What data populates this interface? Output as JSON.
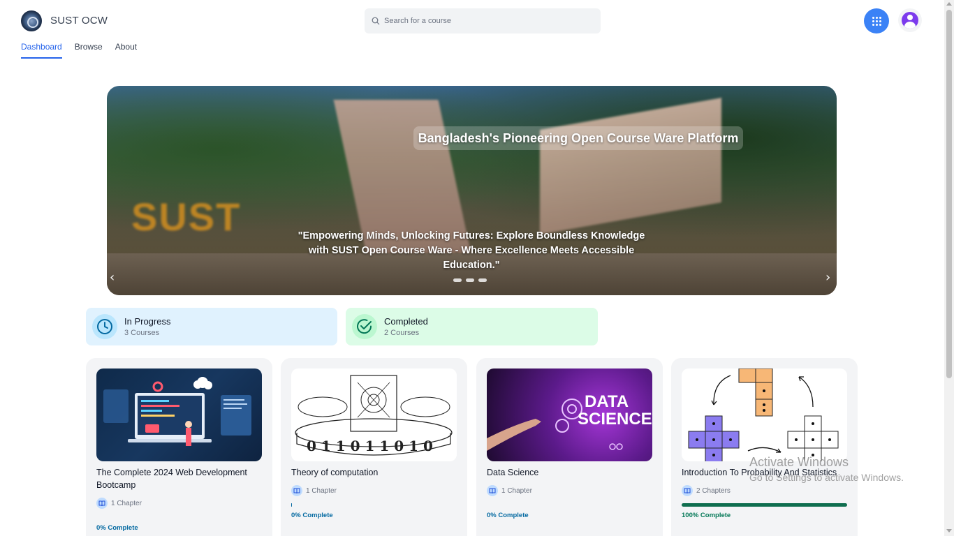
{
  "header": {
    "brand": "SUST OCW",
    "nav": [
      {
        "label": "Dashboard",
        "active": true
      },
      {
        "label": "Browse",
        "active": false
      },
      {
        "label": "About",
        "active": false
      }
    ],
    "search_placeholder": "Search for a course",
    "accent_color": "#2563eb"
  },
  "hero": {
    "title": "Bangladesh's Pioneering Open Course Ware Platform",
    "quote": "\"Empowering Minds, Unlocking Futures: Explore Boundless Knowledge with SUST Open Course Ware - Where Excellence Meets Accessible Education.\"",
    "sign_text": "SUST",
    "slide_count": 3,
    "prev_icon": "chevron-left-icon",
    "next_icon": "chevron-right-icon"
  },
  "status": {
    "in_progress": {
      "title": "In Progress",
      "count": "3 Courses",
      "icon": "clock-icon",
      "color": "#e0f2fe"
    },
    "completed": {
      "title": "Completed",
      "count": "2 Courses",
      "icon": "check-circle-icon",
      "color": "#dcfce7"
    }
  },
  "courses": [
    {
      "title": "The Complete 2024 Web Development Bootcamp",
      "chapters": "1 Chapter",
      "progress": 0,
      "progress_label": "0% Complete"
    },
    {
      "title": "Theory of computation",
      "chapters": "1 Chapter",
      "progress": 0,
      "progress_label": "0% Complete"
    },
    {
      "title": "Data Science",
      "chapters": "1 Chapter",
      "progress": 0,
      "progress_label": "0% Complete",
      "image_text": [
        "DATA",
        "SCIENCE"
      ]
    },
    {
      "title": "Introduction To Probability And Statistics",
      "chapters": "2 Chapters",
      "progress": 100,
      "progress_label": "100% Complete"
    }
  ],
  "watermark": {
    "line1": "Activate Windows",
    "line2": "Go to Settings to activate Windows."
  }
}
